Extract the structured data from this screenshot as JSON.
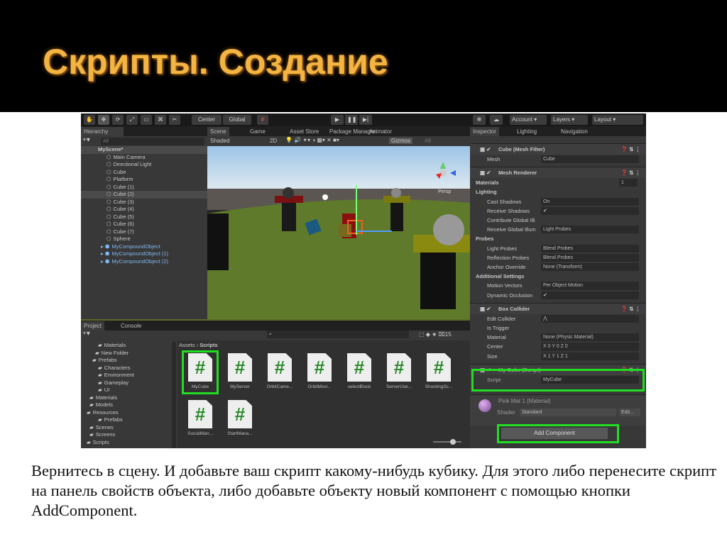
{
  "slide": {
    "title": "Скрипты. Создание",
    "body": "Вернитесь в сцену. И добавьте ваш скрипт какому-нибудь кубику. Для этого либо перенесите скрипт на панель свойств объекта, либо добавьте объекту новый компонент с помощью кнопки AddComponent."
  },
  "toolbar": {
    "center": "Center",
    "global": "Global",
    "account": "Account",
    "layers": "Layers",
    "layout": "Layout"
  },
  "hierarchy": {
    "tab": "Hierarchy",
    "search": "All",
    "scene": "MyScene*",
    "items": [
      "Main Camera",
      "Directional Light",
      "Cube",
      "Platform",
      "Cube (1)",
      "Cube (2)",
      "Cube (3)",
      "Cube (4)",
      "Cube (5)",
      "Cube (6)",
      "Cube (7)",
      "Sphere",
      "MyCompoundObject",
      "MyCompoundObject (1)",
      "MyCompoundObject (2)"
    ]
  },
  "scene": {
    "tabs": [
      "Scene",
      "Game",
      "Asset Store",
      "Package Manager",
      "Animator"
    ],
    "shading": "Shaded",
    "mode2d": "2D",
    "gizmos": "Gizmos",
    "search": "All",
    "persp": "Persp"
  },
  "project": {
    "tabs": [
      "Project",
      "Console"
    ],
    "count": "15",
    "breadcrumb": [
      "Assets",
      "Scripts"
    ],
    "tree": [
      "Materials",
      "New Folder",
      "Prefabs",
      "Characters",
      "Environment",
      "Gameplay",
      "UI",
      "Materials",
      "Models",
      "Resources",
      "Prefabs",
      "Scenes",
      "Screens",
      "Scripts"
    ],
    "scripts": [
      "MyCube",
      "MyServer",
      "OrbitCame...",
      "OrbitMovi...",
      "selectBlock",
      "ServerUse...",
      "ShootingSc...",
      "SocialMan...",
      "StartMana..."
    ]
  },
  "inspector": {
    "tabs": [
      "Inspector",
      "Lighting",
      "Navigation"
    ],
    "rows": [
      [
        "h",
        "Cube (Mesh Filter)",
        ""
      ],
      [
        "f",
        "Mesh",
        "Cube"
      ],
      [
        "h",
        "Mesh Renderer",
        ""
      ],
      [
        "s",
        "Materials",
        "1"
      ],
      [
        "s",
        "Lighting",
        ""
      ],
      [
        "f",
        "Cast Shadows",
        "On"
      ],
      [
        "f",
        "Receive Shadows",
        "✔"
      ],
      [
        "f",
        "Contribute Global Illi",
        ""
      ],
      [
        "f",
        "Receive Global Illum",
        "Light Probes"
      ],
      [
        "s",
        "Probes",
        ""
      ],
      [
        "f",
        "Light Probes",
        "Blend Probes"
      ],
      [
        "f",
        "Reflection Probes",
        "Blend Probes"
      ],
      [
        "f",
        "Anchor Override",
        "None (Transform)"
      ],
      [
        "s",
        "Additional Settings",
        ""
      ],
      [
        "f",
        "Motion Vectors",
        "Per Object Motion"
      ],
      [
        "f",
        "Dynamic Occlusion",
        "✔"
      ],
      [
        "h",
        "Box Collider",
        ""
      ],
      [
        "f",
        "Edit Collider",
        "⋀"
      ],
      [
        "f",
        "Is Trigger",
        ""
      ],
      [
        "f",
        "Material",
        "None (Physic Material)"
      ],
      [
        "f",
        "Center",
        "X 0   Y 0   Z 0"
      ],
      [
        "f",
        "Size",
        "X 1   Y 1   Z 1"
      ],
      [
        "h",
        "My Cube (Script)",
        ""
      ],
      [
        "f",
        "Script",
        "MyCube"
      ]
    ],
    "material": "Pink Mat 1 (Material)",
    "shader_label": "Shader",
    "shader": "Standard",
    "edit": "Edit...",
    "add_component": "Add Component"
  },
  "colors": {
    "highlight": "#22dd22",
    "title": "#f3b443"
  }
}
